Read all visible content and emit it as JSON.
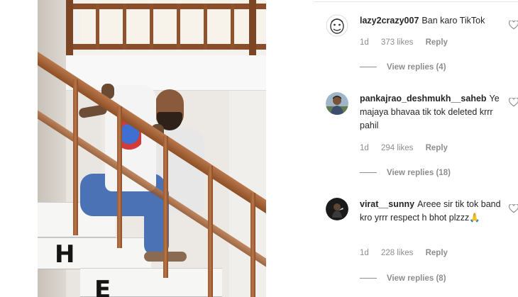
{
  "media": {
    "stair_letters": [
      "H",
      "E"
    ]
  },
  "comments": [
    {
      "username": "lazy2crazy007",
      "text": "Ban karo TikTok",
      "likes": "373 likes",
      "time": "1d",
      "reply_label": "Reply",
      "view_replies": "View replies (4)",
      "avatar_icon": "sketch-face-avatar",
      "like_icon": "heart-outline-icon"
    },
    {
      "username": "pankajrao_deshmukh__saheb",
      "text": "Ye majaya bhavaa tik tok deleted krrr pahil",
      "likes": "294 likes",
      "time": "1d",
      "reply_label": "Reply",
      "view_replies": "View replies (18)",
      "avatar_icon": "profile-photo-avatar",
      "like_icon": "heart-outline-icon"
    },
    {
      "username": "virat__sunny",
      "text": "Areee sir tik tok band kro yrrr respect h bhot plzzz🙏",
      "likes": "228 likes",
      "time": "1d",
      "reply_label": "Reply",
      "view_replies": "View replies (8)",
      "avatar_icon": "dark-profile-avatar",
      "like_icon": "heart-outline-icon"
    }
  ],
  "colors": {
    "text_primary": "#262626",
    "text_secondary": "#8e8e8e",
    "wood": "#9b5a30"
  }
}
